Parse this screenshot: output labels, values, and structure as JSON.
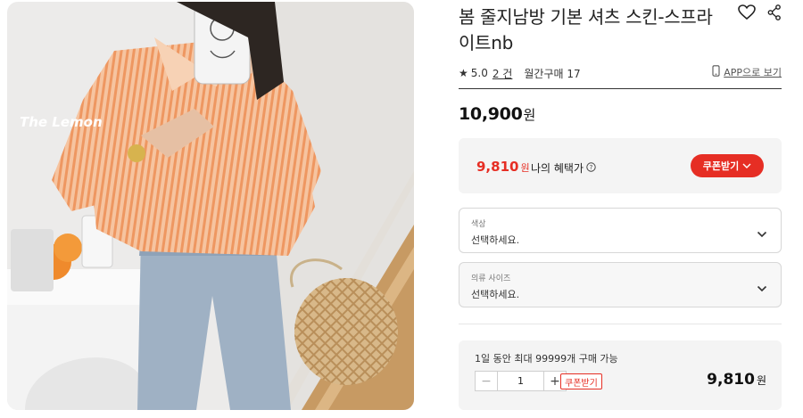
{
  "product": {
    "image_watermark": "The Lemon",
    "title": "봄 줄지남방 기본 셔츠 스킨-스프라이트nb",
    "rating": "5.0",
    "review_count": "2 건",
    "monthly_purchase": "월간구매 17",
    "app_link": "APP으로 보기",
    "price": "10,900",
    "currency": "원"
  },
  "benefit": {
    "price": "9,810",
    "currency": "원",
    "label": "나의 혜택가",
    "coupon_button": "쿠폰받기"
  },
  "options": [
    {
      "label": "색상",
      "value": "선택하세요."
    },
    {
      "label": "의류 사이즈",
      "value": "선택하세요."
    }
  ],
  "order": {
    "limit_text": "1일 동안 최대 99999개 구매 가능",
    "quantity": "1",
    "minus": "−",
    "plus": "+",
    "coupon_tag": "쿠폰받기",
    "total": "9,810",
    "currency": "원"
  },
  "colors": {
    "accent": "#e62e24",
    "panel": "#f4f4f4",
    "shirt": "#f0a06e"
  },
  "icons": [
    "heart-icon",
    "share-icon",
    "star-icon",
    "phone-icon",
    "help-icon",
    "chevron-down-icon"
  ]
}
